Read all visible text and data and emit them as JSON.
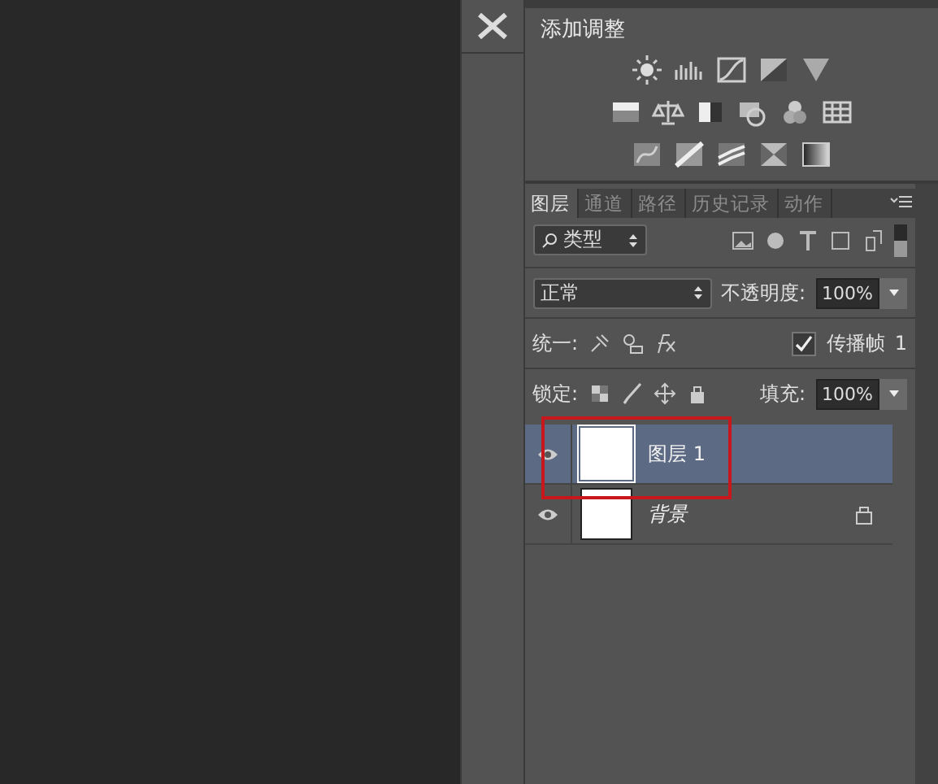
{
  "adjustments": {
    "title": "添加调整"
  },
  "layers_panel": {
    "tabs": [
      {
        "label": "图层",
        "selected": true
      },
      {
        "label": "通道",
        "selected": false
      },
      {
        "label": "路径",
        "selected": false
      },
      {
        "label": "历史记录",
        "selected": false
      },
      {
        "label": "动作",
        "selected": false
      }
    ],
    "filter": {
      "value": "类型"
    },
    "blend_mode": {
      "value": "正常"
    },
    "opacity": {
      "label": "不透明度:",
      "value": "100%"
    },
    "unify": {
      "label": "统一:"
    },
    "propagate": {
      "label": "传播帧",
      "checked": true,
      "count": "1"
    },
    "lock": {
      "label": "锁定:"
    },
    "fill": {
      "label": "填充:",
      "value": "100%"
    },
    "layers": [
      {
        "name": "图层 1",
        "kind": "layer",
        "selected": true,
        "visible": true,
        "locked": false
      },
      {
        "name": "背景",
        "kind": "background",
        "selected": false,
        "visible": true,
        "locked": true
      }
    ]
  }
}
